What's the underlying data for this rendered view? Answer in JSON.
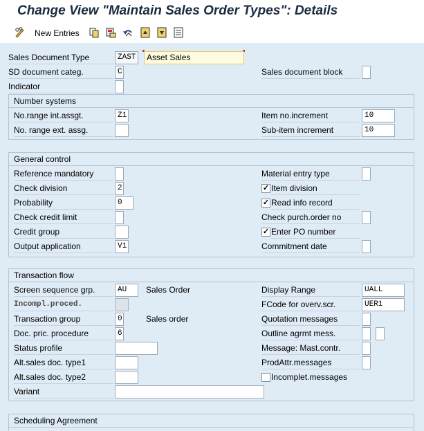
{
  "window": {
    "title": "Change View \"Maintain Sales Order Types\": Details"
  },
  "toolbar": {
    "new_entries_label": "New Entries"
  },
  "header": {
    "sales_doc_type": {
      "label": "Sales Document Type",
      "code": "ZAST",
      "description": "Asset Sales"
    },
    "sd_doc_categ": {
      "label": "SD document categ.",
      "value": "C"
    },
    "sales_doc_block": {
      "label": "Sales document block",
      "checked": false
    },
    "indicator": {
      "label": "Indicator",
      "value": ""
    }
  },
  "number_systems": {
    "title": "Number systems",
    "no_range_int": {
      "label": "No.range int.assgt.",
      "value": "Z1"
    },
    "no_range_ext": {
      "label": "No. range ext. assg.",
      "value": ""
    },
    "item_no_increment": {
      "label": "Item no.increment",
      "value": "10"
    },
    "sub_item_increment": {
      "label": "Sub-item increment",
      "value": "10"
    }
  },
  "general_control": {
    "title": "General control",
    "reference_mandatory": {
      "label": "Reference mandatory",
      "value": ""
    },
    "check_division": {
      "label": "Check division",
      "value": "2"
    },
    "probability": {
      "label": "Probability",
      "value": "0"
    },
    "check_credit_limit": {
      "label": "Check credit limit",
      "value": ""
    },
    "credit_group": {
      "label": "Credit group",
      "value": ""
    },
    "output_application": {
      "label": "Output application",
      "value": "V1"
    },
    "material_entry_type": {
      "label": "Material entry type",
      "value": ""
    },
    "item_division": {
      "label": "Item division",
      "checked": true
    },
    "read_info_record": {
      "label": "Read info record",
      "checked": true
    },
    "check_purch_order": {
      "label": "Check purch.order no",
      "value": ""
    },
    "enter_po_number": {
      "label": "Enter PO number",
      "checked": true
    },
    "commitment_date": {
      "label": "Commitment  date",
      "value": ""
    }
  },
  "transaction_flow": {
    "title": "Transaction flow",
    "screen_seq_grp": {
      "label": "Screen sequence grp.",
      "value": "AU",
      "description": "Sales Order"
    },
    "incompl_proced": {
      "label": "Incompl.proced.",
      "value": ""
    },
    "transaction_group": {
      "label": "Transaction group",
      "value": "0",
      "description": "Sales order"
    },
    "doc_pric_procedure": {
      "label": "Doc. pric. procedure",
      "value": "6"
    },
    "status_profile": {
      "label": "Status profile",
      "value": ""
    },
    "alt_sales_doc_type1": {
      "label": "Alt.sales doc. type1",
      "value": ""
    },
    "alt_sales_doc_type2": {
      "label": "Alt.sales doc. type2",
      "value": ""
    },
    "variant": {
      "label": "Variant",
      "value": ""
    },
    "display_range": {
      "label": "Display Range",
      "value": "UALL"
    },
    "fcode_overv_scr": {
      "label": "FCode for overv.scr.",
      "value": "UER1"
    },
    "quotation_messages": {
      "label": "Quotation messages",
      "value": ""
    },
    "outline_agrmt_mess": {
      "label": "Outline agrmt mess.",
      "value": ""
    },
    "message_mast_contr": {
      "label": "Message: Mast.contr.",
      "value": ""
    },
    "prodattr_messages": {
      "label": "ProdAttr.messages",
      "value": ""
    },
    "incomplet_messages": {
      "label": "Incomplet.messages",
      "checked": false
    }
  },
  "scheduling_agreement": {
    "title": "Scheduling Agreement"
  },
  "icons": [
    "pencil-glasses-icon",
    "copy-icon",
    "save-variant-icon",
    "undo-icon",
    "previous-entry-icon",
    "next-entry-icon",
    "other-entry-icon"
  ],
  "colors": {
    "content_bg": "#dfebf5",
    "title": "#1a2c40",
    "focus_field": "#fffbe0"
  }
}
